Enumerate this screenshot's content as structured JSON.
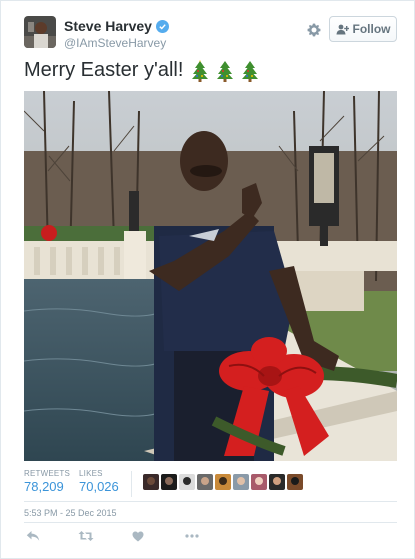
{
  "user": {
    "display_name": "Steve Harvey",
    "handle": "@IAmSteveHarvey",
    "verified": true
  },
  "header": {
    "follow_label": "Follow",
    "settings_icon": "gear-icon"
  },
  "tweet": {
    "text": "Merry Easter y'all!",
    "emoji": [
      "christmas-tree",
      "christmas-tree",
      "christmas-tree"
    ]
  },
  "stats": {
    "retweets_label": "RETWEETS",
    "retweets_value": "78,209",
    "likes_label": "LIKES",
    "likes_value": "70,026",
    "liker_avatar_count": 9
  },
  "timestamp": "5:53 PM - 25 Dec 2015",
  "actions": [
    "reply-icon",
    "retweet-icon",
    "like-icon",
    "more-icon"
  ],
  "colors": {
    "link": "#3b94d9",
    "verified": "#55acee",
    "muted": "#8899a6",
    "text": "#292f33"
  }
}
